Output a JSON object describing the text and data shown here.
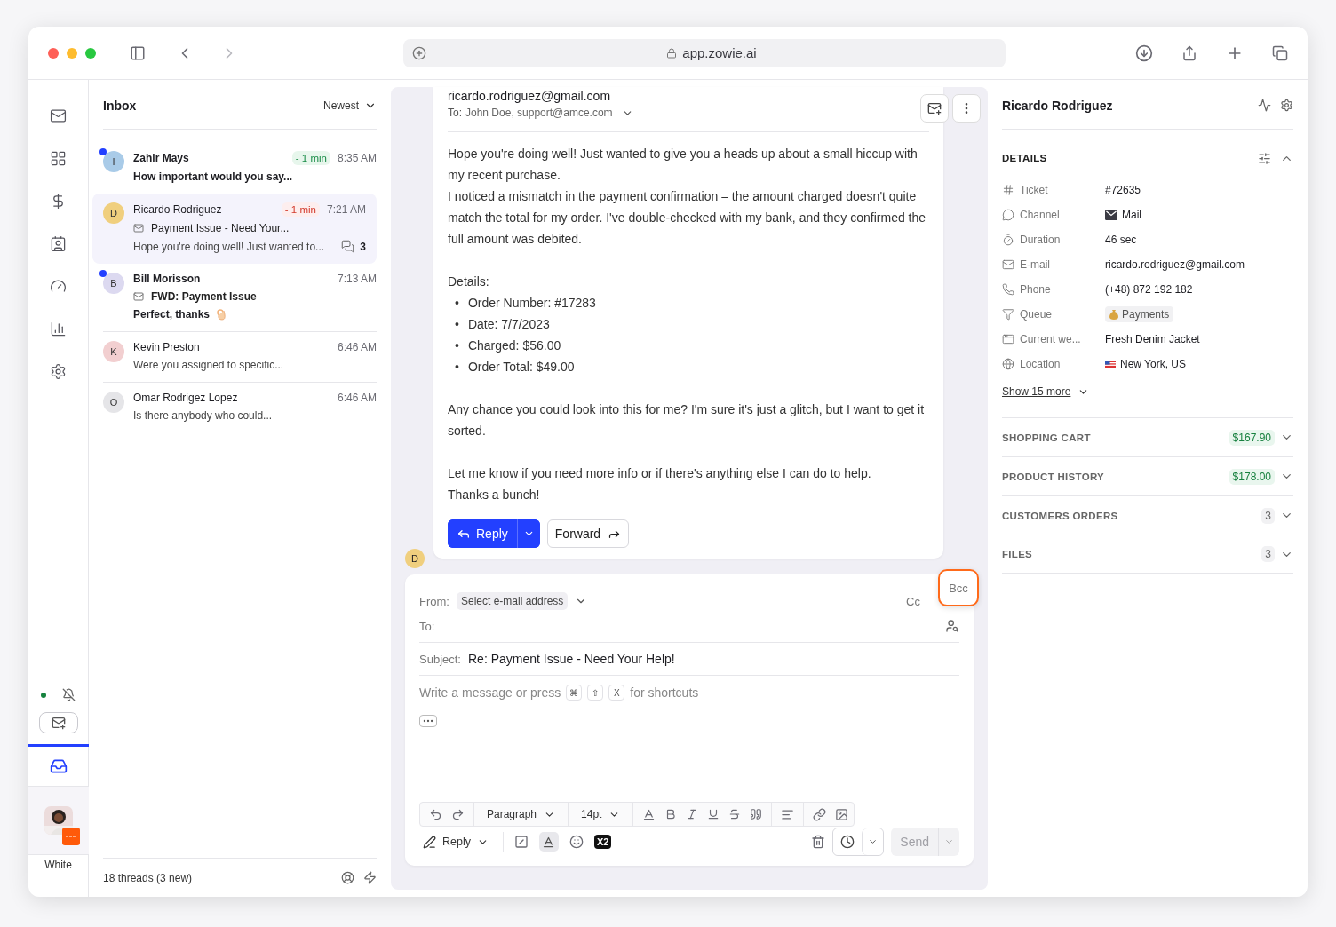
{
  "browser": {
    "url": "app.zowie.ai"
  },
  "rail": {
    "online": true,
    "inbox_selected": true,
    "user_label": "White"
  },
  "inbox": {
    "title": "Inbox",
    "sort": "Newest",
    "footer": "18 threads (3 new)",
    "threads": [
      {
        "initial": "I",
        "name": "Zahir Mays",
        "unread": true,
        "selected": false,
        "color": "#a9cbe8",
        "sla": {
          "text": "- 1 min",
          "kind": "ok"
        },
        "time": "8:35 AM",
        "preview": "How important would you say..."
      },
      {
        "initial": "D",
        "name": "Ricardo Rodriguez",
        "unread": false,
        "selected": true,
        "color": "#f0cf7e",
        "sla": {
          "text": "- 1 min",
          "kind": "late"
        },
        "time": "7:21 AM",
        "subject": "Payment Issue - Need Your...",
        "preview": "Hope you're doing well! Just wanted to...",
        "replies": "3"
      },
      {
        "initial": "B",
        "name": "Bill Morisson",
        "unread": true,
        "selected": false,
        "color": "#dcd9f0",
        "time": "7:13 AM",
        "subject": "FWD: Payment Issue",
        "preview": "Perfect, thanks",
        "emoji": true
      },
      {
        "initial": "K",
        "name": "Kevin Preston",
        "unread": false,
        "selected": false,
        "color": "#f2cfd0",
        "time": "6:46 AM",
        "preview": "Were you assigned to specific..."
      },
      {
        "initial": "O",
        "name": "Omar Rodrigez Lopez",
        "unread": false,
        "selected": false,
        "color": "#e5e5e8",
        "time": "6:46 AM",
        "preview": "Is there anybody who could..."
      }
    ]
  },
  "message": {
    "from": "ricardo.rodriguez@gmail.com",
    "to_label": "To:",
    "to": "John Doe, support@amce.com",
    "sender_initial": "D",
    "body": [
      {
        "kind": "text",
        "lines": [
          "Hope you're doing well! Just wanted to give you a heads up about a small hiccup with my recent purchase.",
          "I noticed a mismatch in the payment confirmation – the amount charged doesn't quite match the total for my order. I've double-checked with my bank, and they confirmed the full amount was debited."
        ]
      },
      {
        "kind": "list",
        "title": "Details:",
        "bullet": "•",
        "items": [
          "Order Number: #17283",
          "Date: 7/7/2023",
          "Charged: $56.00",
          "Order Total: $49.00"
        ]
      },
      {
        "kind": "text",
        "lines": [
          "Any chance you could look into this for me? I'm sure it's just a glitch, but I want to get it sorted."
        ]
      },
      {
        "kind": "text",
        "lines": [
          "Let me know if you need more info or if there's anything else I can do to help.",
          "Thanks a bunch!"
        ]
      }
    ],
    "reply": "Reply",
    "forward": "Forward"
  },
  "composer": {
    "from_label": "From:",
    "from_placeholder": "Select e-mail address",
    "cc": "Cc",
    "bcc": "Bcc",
    "bcc_highlighted": true,
    "to_label": "To:",
    "subject_label": "Subject:",
    "subject": "Re: Payment Issue - Need Your Help!",
    "hint": "Write a message or press",
    "keys": [
      "⌘",
      "⇧",
      "X"
    ],
    "hint_after": "for shortcuts",
    "paragraph": "Paragraph",
    "size": "14pt",
    "mode": "Reply",
    "x2": "X2",
    "send": "Send",
    "send_disabled": true
  },
  "contact": {
    "name": "Ricardo Rodriguez",
    "details_title": "DETAILS",
    "details_expanded": true,
    "fields": [
      {
        "label": "Ticket",
        "value": "#72635",
        "kind": "plain"
      },
      {
        "label": "Channel",
        "value": "Mail",
        "kind": "mail"
      },
      {
        "label": "Duration",
        "value": "46 sec",
        "kind": "plain"
      },
      {
        "label": "E-mail",
        "value": "ricardo.rodriguez@gmail.com",
        "kind": "plain"
      },
      {
        "label": "Phone",
        "value": "(+48) 872 192 182",
        "kind": "plain"
      },
      {
        "label": "Queue",
        "value": "Payments",
        "kind": "tag"
      },
      {
        "label": "Current we...",
        "value": "Fresh Denim Jacket",
        "kind": "plain"
      },
      {
        "label": "Location",
        "value": "New York, US",
        "kind": "flag"
      }
    ],
    "show_more": "Show 15 more",
    "sections": [
      {
        "title": "SHOPPING CART",
        "badge": "$167.90",
        "kind": "money"
      },
      {
        "title": "PRODUCT HISTORY",
        "badge": "$178.00",
        "kind": "money"
      },
      {
        "title": "CUSTOMERS ORDERS",
        "badge": "3",
        "kind": "count"
      },
      {
        "title": "FILES",
        "badge": "3",
        "kind": "count"
      }
    ]
  }
}
